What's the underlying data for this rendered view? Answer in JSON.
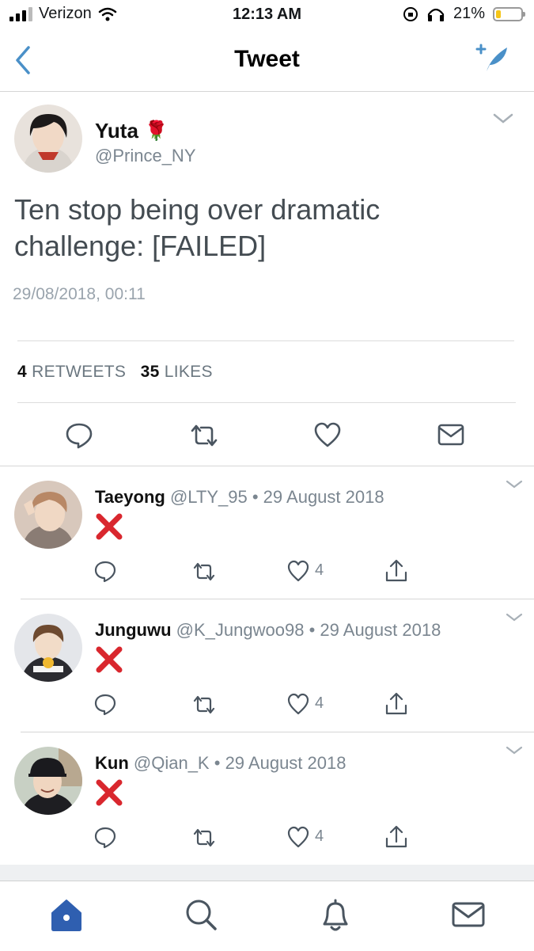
{
  "status_bar": {
    "carrier": "Verizon",
    "time": "12:13 AM",
    "battery": "21%",
    "battery_level": 0.21
  },
  "nav": {
    "title": "Tweet"
  },
  "tweet": {
    "author_name": "Yuta",
    "author_emoji": "🌹",
    "author_handle": "@Prince_NY",
    "text_line1": "Ten stop being over dramatic",
    "text_line2": "challenge: [FAILED]",
    "timestamp": "29/08/2018, 00:11",
    "retweet_count": "4",
    "retweet_label": "RETWEETS",
    "like_count": "35",
    "like_label": "LIKES"
  },
  "replies": [
    {
      "name": "Taeyong",
      "handle": "@LTY_95",
      "date": "29 August 2018",
      "like_count": "4"
    },
    {
      "name": "Junguwu",
      "handle": "@K_Jungwoo98",
      "date": "29 August 2018",
      "like_count": "4"
    },
    {
      "name": "Kun",
      "handle": "@Qian_K",
      "date": "29 August 2018",
      "like_count": "4"
    }
  ],
  "separator": "•",
  "colors": {
    "accent": "#4a90c8",
    "home_tab": "#2f5fb0",
    "cross_red": "#d9272e"
  }
}
